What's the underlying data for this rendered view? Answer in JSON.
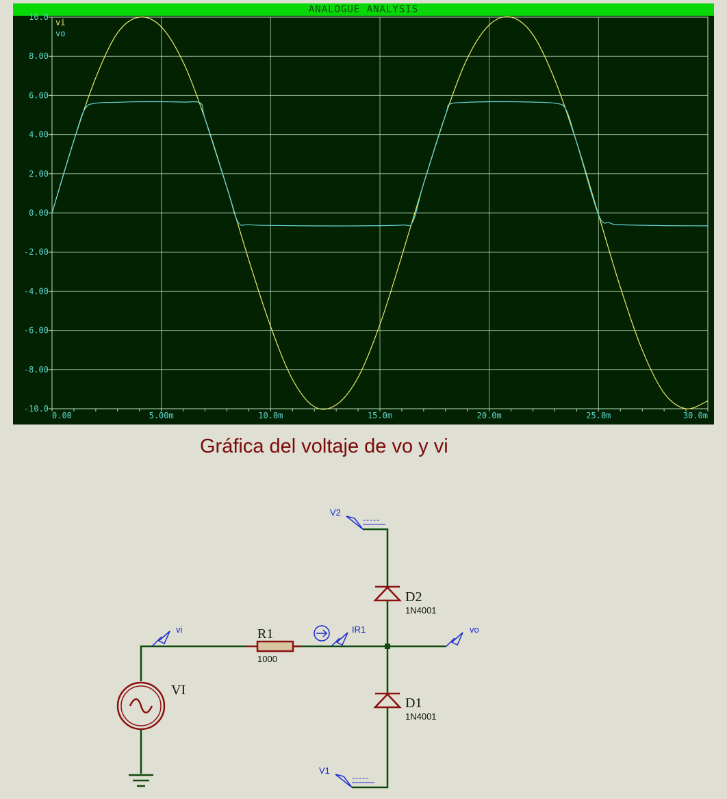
{
  "graph": {
    "title": "ANALOGUE ANALYSIS",
    "legend": [
      {
        "name": "vi",
        "color": "#eded6a"
      },
      {
        "name": "vo",
        "color": "#6ad6de"
      }
    ],
    "background": "#022202",
    "grid_color": "#bfe0bf"
  },
  "chart_data": {
    "type": "line",
    "title": "ANALOGUE ANALYSIS",
    "xlabel": "",
    "ylabel": "",
    "xlim": [
      0,
      0.03
    ],
    "ylim": [
      -10,
      10
    ],
    "x_ticks": [
      "0.00",
      "5.00m",
      "10.0m",
      "15.0m",
      "20.0m",
      "25.0m",
      "30.0m"
    ],
    "y_ticks": [
      "10.0",
      "8.00",
      "6.00",
      "4.00",
      "2.00",
      "0.00",
      "-2.00",
      "-4.00",
      "-6.00",
      "-8.00",
      "-10.0"
    ],
    "grid": true,
    "legend_position": "top-left",
    "series": [
      {
        "name": "vi",
        "color": "#eded6a",
        "x": [
          0,
          0.001,
          0.002,
          0.003,
          0.004,
          0.005,
          0.006,
          0.007,
          0.008,
          0.009,
          0.01,
          0.011,
          0.012,
          0.013,
          0.014,
          0.015,
          0.016,
          0.017,
          0.018,
          0.019,
          0.02,
          0.021,
          0.022,
          0.023,
          0.024,
          0.025,
          0.026,
          0.027,
          0.028,
          0.029,
          0.03
        ],
        "values": [
          0,
          3.7,
          6.9,
          9.2,
          10.0,
          9.5,
          7.7,
          4.8,
          1.3,
          -2.4,
          -5.8,
          -8.5,
          -9.9,
          -9.8,
          -8.4,
          -5.7,
          -2.2,
          1.5,
          5.0,
          7.9,
          9.6,
          10.0,
          9.1,
          6.8,
          3.6,
          -0.1,
          -3.8,
          -7.0,
          -9.2,
          -10.0,
          -9.6
        ]
      },
      {
        "name": "vo",
        "color": "#6ad6de",
        "x": [
          0,
          0.001,
          0.0015,
          0.002,
          0.003,
          0.004,
          0.005,
          0.006,
          0.0068,
          0.007,
          0.008,
          0.0085,
          0.009,
          0.01,
          0.012,
          0.014,
          0.016,
          0.0165,
          0.017,
          0.018,
          0.0182,
          0.019,
          0.02,
          0.021,
          0.022,
          0.023,
          0.0235,
          0.024,
          0.025,
          0.0255,
          0.026,
          0.028,
          0.03
        ],
        "values": [
          0,
          3.7,
          5.3,
          5.6,
          5.65,
          5.68,
          5.68,
          5.66,
          5.6,
          4.8,
          1.3,
          -0.45,
          -0.6,
          -0.64,
          -0.66,
          -0.66,
          -0.62,
          -0.45,
          1.5,
          5.0,
          5.55,
          5.65,
          5.68,
          5.68,
          5.66,
          5.6,
          5.3,
          3.6,
          -0.1,
          -0.5,
          -0.6,
          -0.65,
          -0.66
        ]
      }
    ]
  },
  "caption": "Gráfica del voltaje de vo y vi",
  "schematic": {
    "wire_color": "#0d4a0d",
    "component_color": "#8b1010",
    "probe_color": "#1a2ad0",
    "r1": {
      "ref": "R1",
      "value": "1000"
    },
    "d1": {
      "ref": "D1",
      "value": "1N4001"
    },
    "d2": {
      "ref": "D2",
      "value": "1N4001"
    },
    "vi_source": {
      "ref": "VI"
    },
    "probes": {
      "vi": "vi",
      "vo": "vo",
      "ir1": "IR1",
      "v1": "V1",
      "v2": "V2",
      "v1_value": "-----",
      "v2_value": "-----"
    }
  }
}
